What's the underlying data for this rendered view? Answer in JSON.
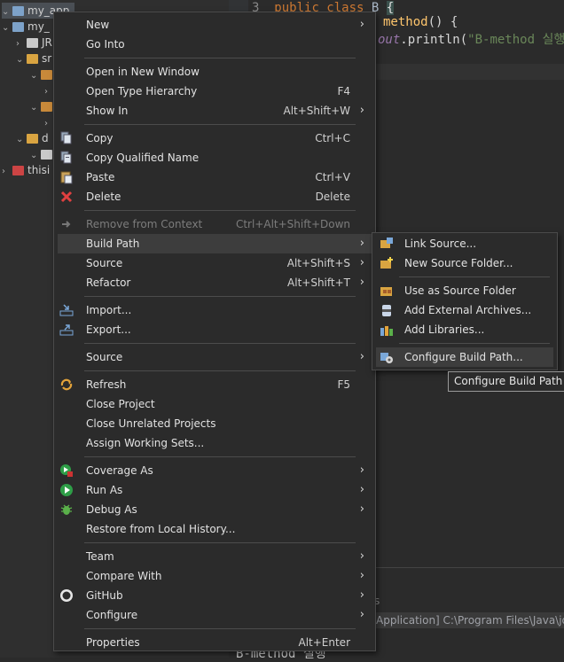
{
  "explorer": {
    "rows": [
      {
        "label": "my_app",
        "indent": 0
      },
      {
        "label": "my_",
        "indent": 0
      },
      {
        "label": "JR",
        "indent": 1
      },
      {
        "label": "sr",
        "indent": 1
      },
      {
        "label": "",
        "indent": 2
      },
      {
        "label": "",
        "indent": 3
      },
      {
        "label": "",
        "indent": 2
      },
      {
        "label": "",
        "indent": 3
      },
      {
        "label": "d",
        "indent": 1
      },
      {
        "label": "",
        "indent": 2
      },
      {
        "label": "thisi",
        "indent": 0
      }
    ]
  },
  "editor": {
    "line_number": "3",
    "line1_kw": "public class",
    "line1_name": "B",
    "line1_brace": "{",
    "line2_method": "method",
    "line2_rest": "() {",
    "line3_out": "out",
    "line3_rest": ".println(",
    "line3_str": "\"B-method 실행\""
  },
  "console": {
    "tab_label": "s",
    "launch_info": "Application] C:\\Program Files\\Java\\jd",
    "output": "B-method 실행"
  },
  "context_menu": {
    "items": [
      {
        "label": "New",
        "accel": "",
        "submenu": true,
        "icon": ""
      },
      {
        "label": "Go Into",
        "accel": "",
        "submenu": false,
        "icon": ""
      },
      {
        "sep": true
      },
      {
        "label": "Open in New Window",
        "accel": "",
        "submenu": false,
        "icon": ""
      },
      {
        "label": "Open Type Hierarchy",
        "accel": "F4",
        "submenu": false,
        "icon": ""
      },
      {
        "label": "Show In",
        "accel": "Alt+Shift+W",
        "submenu": true,
        "icon": ""
      },
      {
        "sep": true
      },
      {
        "label": "Copy",
        "accel": "Ctrl+C",
        "submenu": false,
        "icon": "copy-icon"
      },
      {
        "label": "Copy Qualified Name",
        "accel": "",
        "submenu": false,
        "icon": "copy-qualified-icon"
      },
      {
        "label": "Paste",
        "accel": "Ctrl+V",
        "submenu": false,
        "icon": "paste-icon"
      },
      {
        "label": "Delete",
        "accel": "Delete",
        "submenu": false,
        "icon": "delete-icon"
      },
      {
        "sep": true
      },
      {
        "label": "Remove from Context",
        "accel": "Ctrl+Alt+Shift+Down",
        "submenu": false,
        "icon": "remove-context-icon",
        "disabled": true
      },
      {
        "label": "Build Path",
        "accel": "",
        "submenu": true,
        "icon": "",
        "highlighted": true
      },
      {
        "label": "Source",
        "accel": "Alt+Shift+S",
        "submenu": true,
        "icon": ""
      },
      {
        "label": "Refactor",
        "accel": "Alt+Shift+T",
        "submenu": true,
        "icon": ""
      },
      {
        "sep": true
      },
      {
        "label": "Import...",
        "accel": "",
        "submenu": false,
        "icon": "import-icon"
      },
      {
        "label": "Export...",
        "accel": "",
        "submenu": false,
        "icon": "export-icon"
      },
      {
        "sep": true
      },
      {
        "label": "Source",
        "accel": "",
        "submenu": true,
        "icon": ""
      },
      {
        "sep": true
      },
      {
        "label": "Refresh",
        "accel": "F5",
        "submenu": false,
        "icon": "refresh-icon"
      },
      {
        "label": "Close Project",
        "accel": "",
        "submenu": false,
        "icon": ""
      },
      {
        "label": "Close Unrelated Projects",
        "accel": "",
        "submenu": false,
        "icon": ""
      },
      {
        "label": "Assign Working Sets...",
        "accel": "",
        "submenu": false,
        "icon": ""
      },
      {
        "sep": true
      },
      {
        "label": "Coverage As",
        "accel": "",
        "submenu": true,
        "icon": "coverage-icon"
      },
      {
        "label": "Run As",
        "accel": "",
        "submenu": true,
        "icon": "run-icon"
      },
      {
        "label": "Debug As",
        "accel": "",
        "submenu": true,
        "icon": "debug-icon"
      },
      {
        "label": "Restore from Local History...",
        "accel": "",
        "submenu": false,
        "icon": ""
      },
      {
        "sep": true
      },
      {
        "label": "Team",
        "accel": "",
        "submenu": true,
        "icon": ""
      },
      {
        "label": "Compare With",
        "accel": "",
        "submenu": true,
        "icon": ""
      },
      {
        "label": "GitHub",
        "accel": "",
        "submenu": true,
        "icon": "github-icon"
      },
      {
        "label": "Configure",
        "accel": "",
        "submenu": true,
        "icon": ""
      },
      {
        "sep": true
      },
      {
        "label": "Properties",
        "accel": "Alt+Enter",
        "submenu": false,
        "icon": ""
      }
    ]
  },
  "submenu": {
    "items": [
      {
        "label": "Link Source...",
        "icon": "link-source-icon"
      },
      {
        "label": "New Source Folder...",
        "icon": "new-source-folder-icon"
      },
      {
        "sep": true
      },
      {
        "label": "Use as Source Folder",
        "icon": "source-folder-icon"
      },
      {
        "label": "Add External Archives...",
        "icon": "jar-icon"
      },
      {
        "label": "Add Libraries...",
        "icon": "library-icon"
      },
      {
        "sep": true
      },
      {
        "label": "Configure Build Path...",
        "icon": "configure-build-path-icon",
        "highlighted": true
      }
    ]
  },
  "tooltip": "Configure Build Path",
  "colors": {
    "accent": "#3d3d3d",
    "keyword": "#cc7832",
    "method": "#ffc66d",
    "string": "#6a8759"
  }
}
